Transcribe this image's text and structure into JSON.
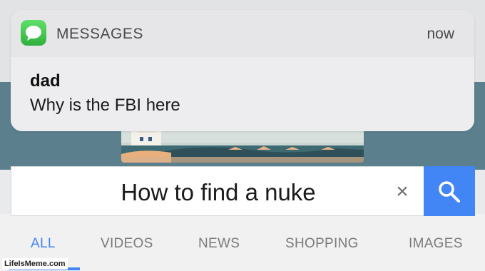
{
  "notification": {
    "app_name": "MESSAGES",
    "time": "now",
    "sender": "dad",
    "message": "Why is the FBI here",
    "app_icon": "messages-bubble-icon"
  },
  "search": {
    "query": "How to find a nuke",
    "clear_label": "×",
    "search_icon": "magnifier-icon"
  },
  "tabs": [
    {
      "label": "ALL",
      "active": true
    },
    {
      "label": "VIDEOS",
      "active": false
    },
    {
      "label": "NEWS",
      "active": false
    },
    {
      "label": "SHOPPING",
      "active": false
    },
    {
      "label": "IMAGES",
      "active": false
    }
  ],
  "watermark": "LifeIsMeme.com",
  "colors": {
    "accent": "#4285f4",
    "messages_green": "#3cc84a",
    "background_teal": "#5c7f8e"
  }
}
